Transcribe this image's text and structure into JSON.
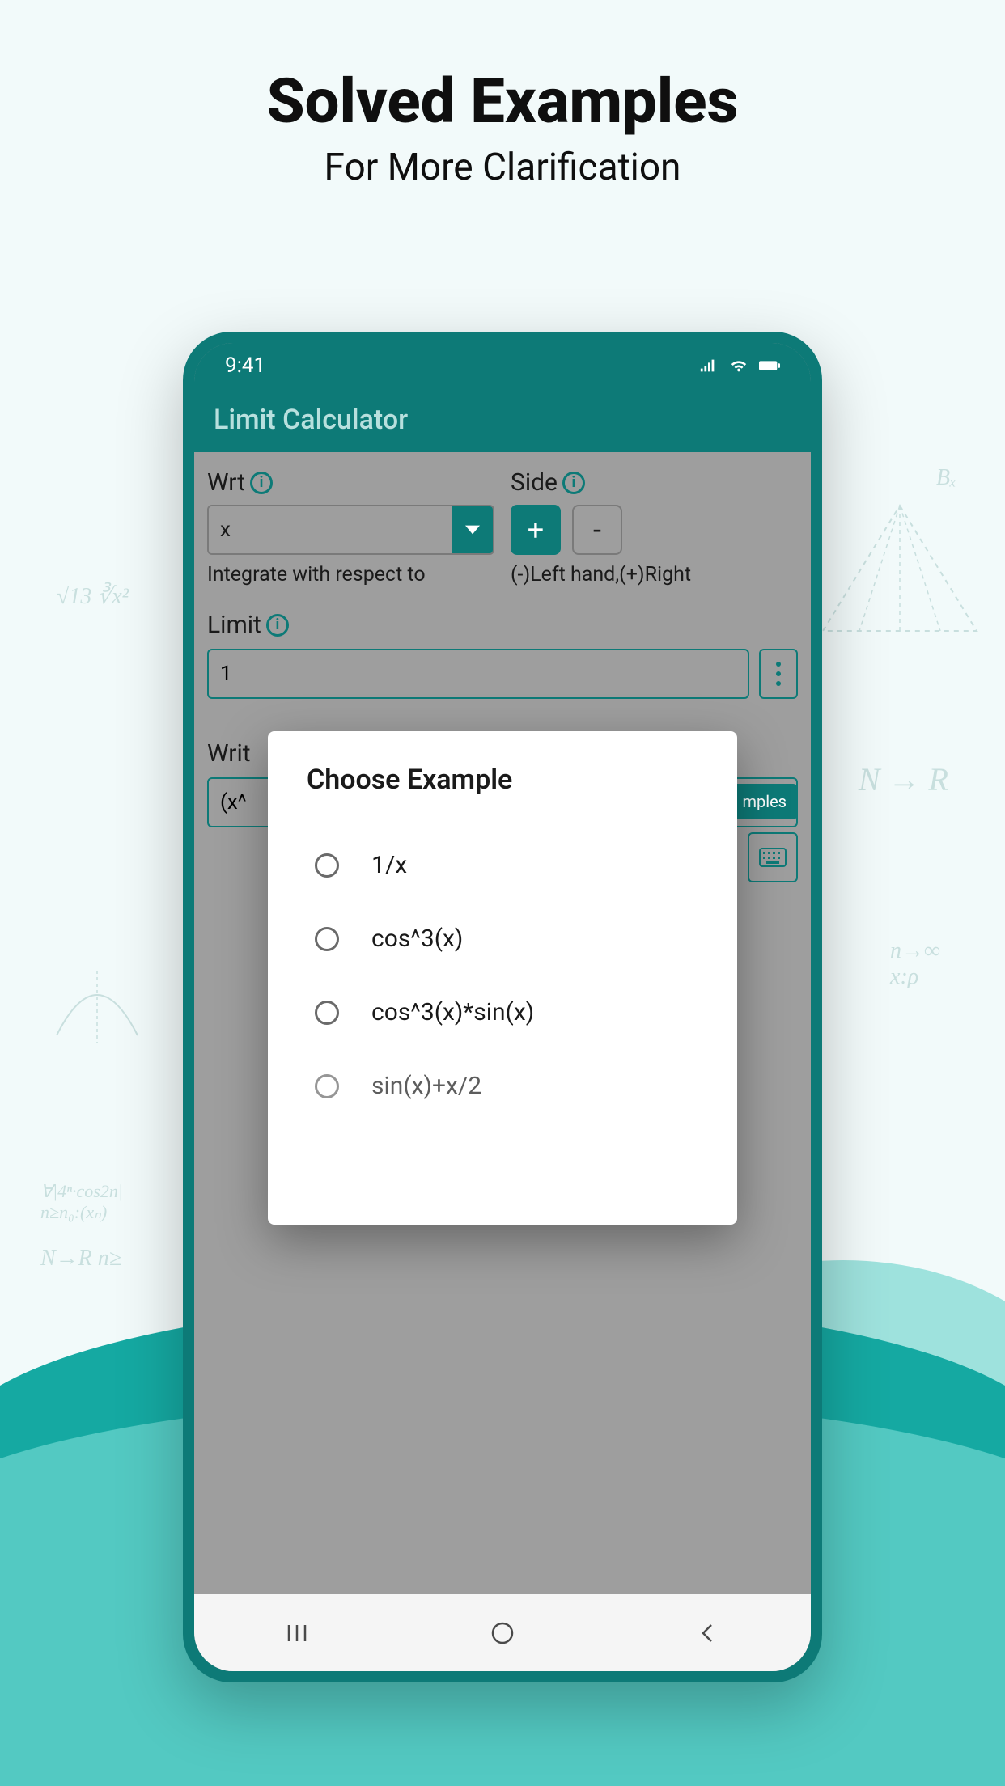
{
  "header": {
    "title": "Solved Examples",
    "subtitle": "For More Clarification"
  },
  "status": {
    "time": "9:41"
  },
  "app": {
    "title": "Limit Calculator"
  },
  "form": {
    "wrt": {
      "label": "Wrt",
      "value": "x",
      "help": "Integrate with respect to"
    },
    "side": {
      "label": "Side",
      "plus": "+",
      "minus": "-",
      "help": "(-)Left hand,(+)Right"
    },
    "limit": {
      "label": "Limit",
      "value": "1"
    },
    "equation": {
      "label": "Writ",
      "value": "(x^"
    },
    "examples_btn": "mples"
  },
  "dialog": {
    "title": "Choose Example",
    "options": [
      "1/x",
      "cos^3(x)",
      "cos^3(x)*sin(x)",
      "sin(x)+x/2"
    ]
  }
}
